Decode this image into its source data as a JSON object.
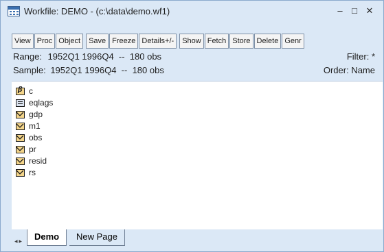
{
  "window": {
    "title": "Workfile: DEMO - (c:\\data\\demo.wf1)",
    "controls": {
      "minimize": "–",
      "maximize": "□",
      "close": "✕"
    }
  },
  "toolbar": {
    "buttons": [
      "View",
      "Proc",
      "Object",
      "Save",
      "Freeze",
      "Details+/-",
      "Show",
      "Fetch",
      "Store",
      "Delete",
      "Genr"
    ]
  },
  "info": {
    "range_label": "Range:",
    "range_value": "1952Q1 1996Q4  --  180 obs",
    "filter": "Filter: *",
    "sample_label": "Sample:",
    "sample_value": "1952Q1 1996Q4  --  180 obs",
    "order": "Order: Name"
  },
  "objects": [
    {
      "name": "c",
      "icon": "coef-icon"
    },
    {
      "name": "eqlags",
      "icon": "equation-icon"
    },
    {
      "name": "gdp",
      "icon": "series-icon"
    },
    {
      "name": "m1",
      "icon": "series-icon"
    },
    {
      "name": "obs",
      "icon": "series-icon"
    },
    {
      "name": "pr",
      "icon": "series-icon"
    },
    {
      "name": "resid",
      "icon": "series-icon"
    },
    {
      "name": "rs",
      "icon": "series-icon"
    }
  ],
  "tabs": {
    "nav": "◂▸",
    "active": "Demo",
    "inactive": "New Page"
  }
}
